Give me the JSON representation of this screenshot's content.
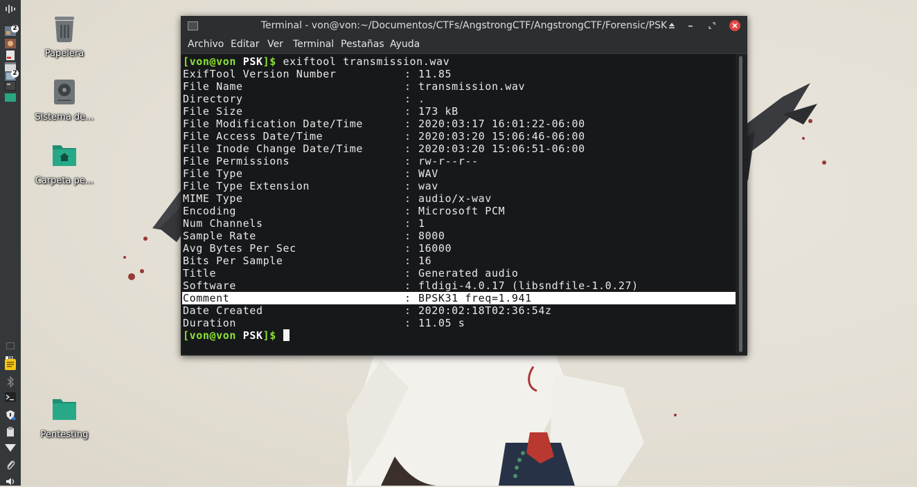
{
  "desktop": {
    "icons": [
      {
        "label": "Papelera",
        "icon": "trash-icon"
      },
      {
        "label": "Sistema de...",
        "icon": "drive-icon"
      },
      {
        "label": "Carpeta pe...",
        "icon": "home-folder-icon"
      },
      {
        "label": "Pentesting",
        "icon": "folder-icon"
      }
    ]
  },
  "panel": {
    "badges": [
      "2",
      "2"
    ]
  },
  "terminal": {
    "title": "Terminal - von@von:~/Documentos/CTFs/AngstrongCTF/AngstrongCTF/Forensic/PSK",
    "menu": [
      "Archivo",
      "Editar",
      "Ver",
      "Terminal",
      "Pestañas",
      "Ayuda"
    ],
    "prompt": {
      "user": "[von@von",
      "dir": "PSK",
      "end": "]$"
    },
    "command": "exiftool transmission.wav",
    "separator": ":",
    "rows": [
      {
        "key": "ExifTool Version Number",
        "value": "11.85"
      },
      {
        "key": "File Name",
        "value": "transmission.wav"
      },
      {
        "key": "Directory",
        "value": "."
      },
      {
        "key": "File Size",
        "value": "173 kB"
      },
      {
        "key": "File Modification Date/Time",
        "value": "2020:03:17 16:01:22-06:00"
      },
      {
        "key": "File Access Date/Time",
        "value": "2020:03:20 15:06:46-06:00"
      },
      {
        "key": "File Inode Change Date/Time",
        "value": "2020:03:20 15:06:51-06:00"
      },
      {
        "key": "File Permissions",
        "value": "rw-r--r--"
      },
      {
        "key": "File Type",
        "value": "WAV"
      },
      {
        "key": "File Type Extension",
        "value": "wav"
      },
      {
        "key": "MIME Type",
        "value": "audio/x-wav"
      },
      {
        "key": "Encoding",
        "value": "Microsoft PCM"
      },
      {
        "key": "Num Channels",
        "value": "1"
      },
      {
        "key": "Sample Rate",
        "value": "8000"
      },
      {
        "key": "Avg Bytes Per Sec",
        "value": "16000"
      },
      {
        "key": "Bits Per Sample",
        "value": "16"
      },
      {
        "key": "Title",
        "value": "Generated audio"
      },
      {
        "key": "Software",
        "value": "fldigi-4.0.17 (libsndfile-1.0.27)"
      },
      {
        "key": "Comment",
        "value": "BPSK31 freq=1.941",
        "highlighted": true
      },
      {
        "key": "Date Created",
        "value": "2020:02:18T02:36:54z"
      },
      {
        "key": "Duration",
        "value": "11.05 s"
      }
    ],
    "colors": {
      "prompt_green": "#8ae234",
      "close_button": "#e04545",
      "background": "#1f2123"
    }
  }
}
